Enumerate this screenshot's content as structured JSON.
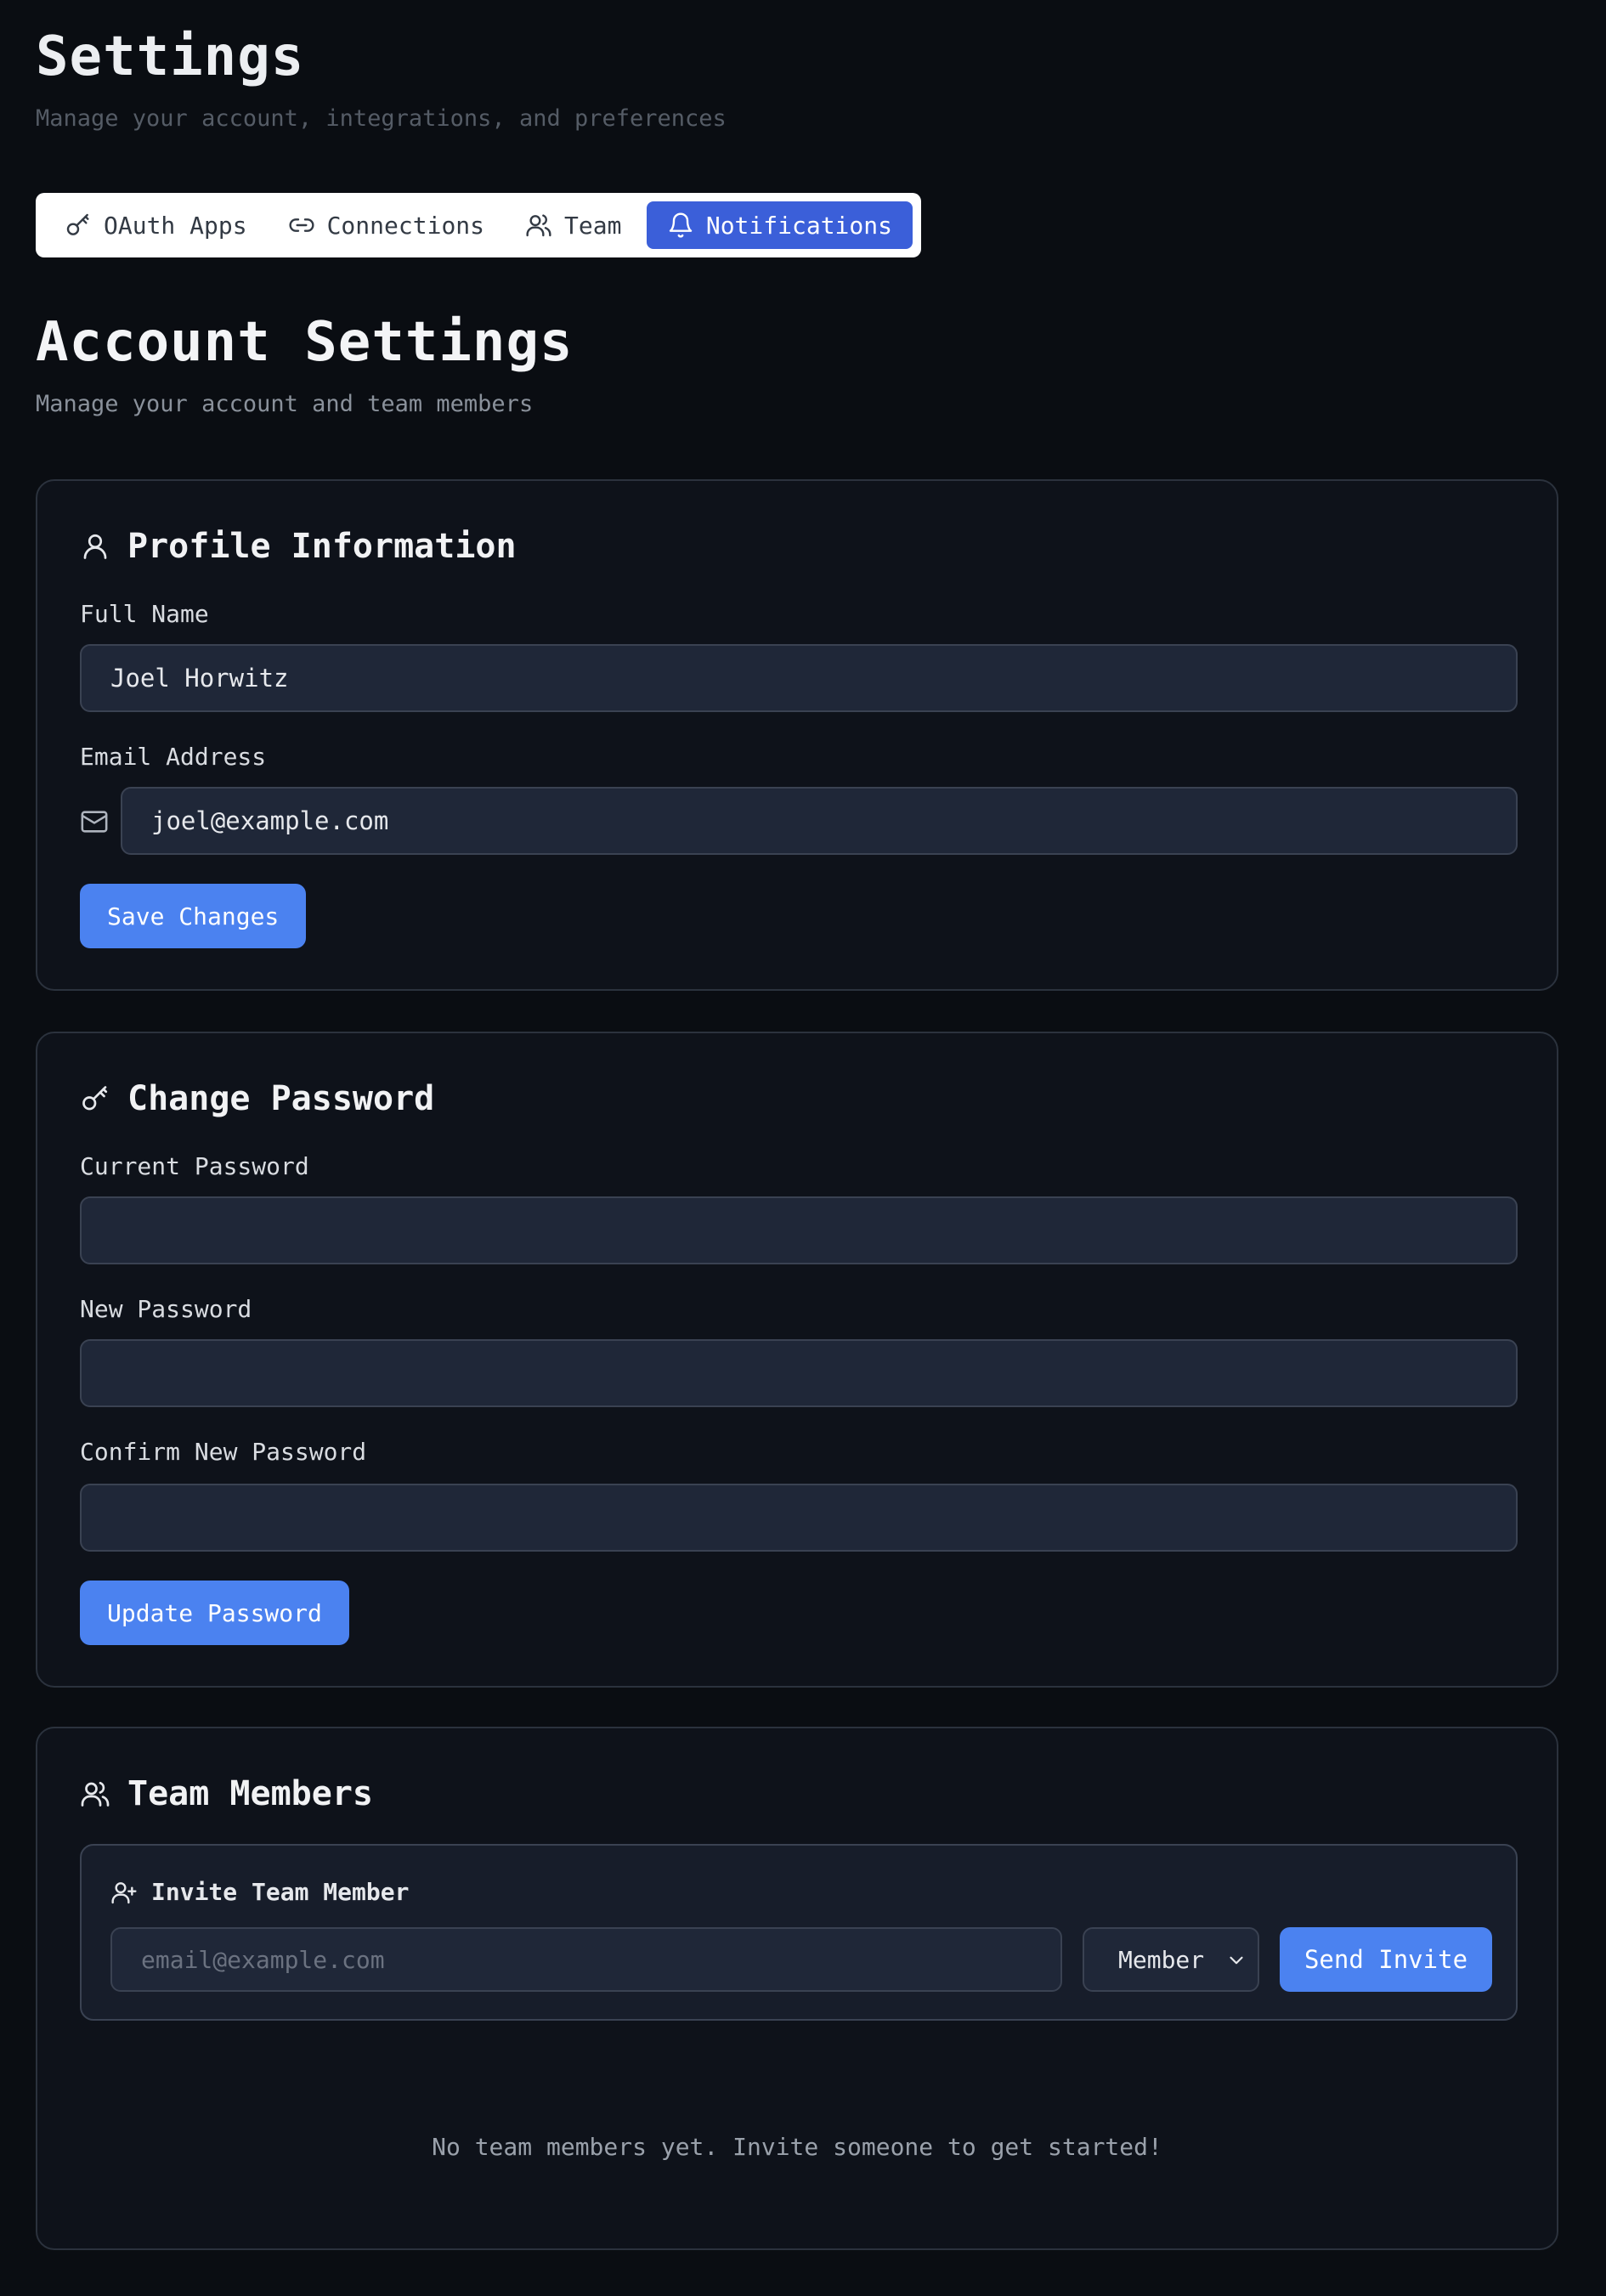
{
  "header": {
    "title": "Settings",
    "subtitle": "Manage your account, integrations, and preferences"
  },
  "tabs": [
    {
      "label": "OAuth Apps",
      "icon": "key-icon"
    },
    {
      "label": "Connections",
      "icon": "link-icon"
    },
    {
      "label": "Team",
      "icon": "users-icon"
    },
    {
      "label": "Notifications",
      "icon": "bell-icon",
      "active": true
    }
  ],
  "section": {
    "title": "Account Settings",
    "subtitle": "Manage your account and team members"
  },
  "profile": {
    "heading": "Profile Information",
    "full_name_label": "Full Name",
    "full_name_value": "Joel Horwitz",
    "email_label": "Email Address",
    "email_value": "joel@example.com",
    "save_label": "Save Changes"
  },
  "password": {
    "heading": "Change Password",
    "current_label": "Current Password",
    "new_label": "New Password",
    "confirm_label": "Confirm New Password",
    "update_label": "Update Password"
  },
  "team": {
    "heading": "Team Members",
    "invite_heading": "Invite Team Member",
    "invite_placeholder": "email@example.com",
    "role_value": "Member",
    "send_label": "Send Invite",
    "empty_text": "No team members yet. Invite someone to get started!"
  },
  "colors": {
    "background": "#0a0d12",
    "card": "#0e121a",
    "accent": "#4b82f0",
    "active_tab": "#3b5fd9"
  }
}
